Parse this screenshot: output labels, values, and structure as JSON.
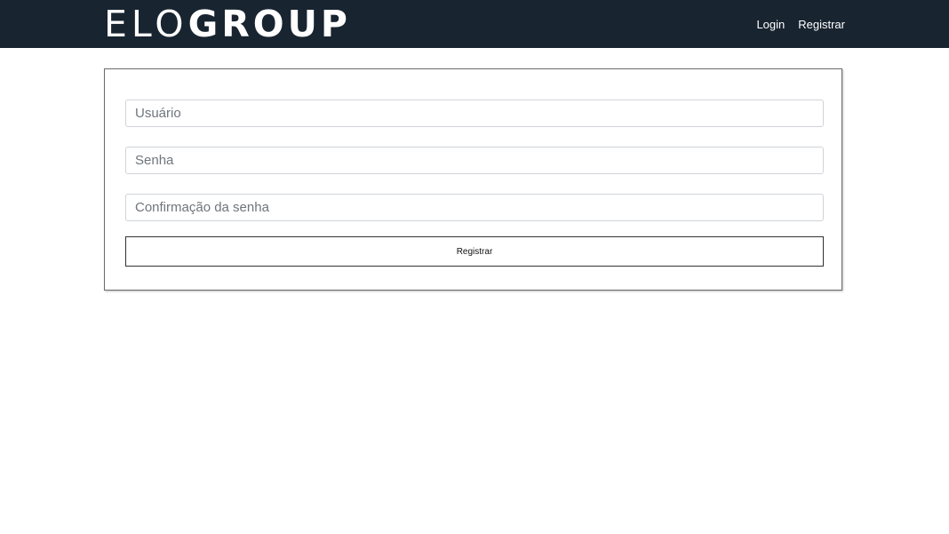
{
  "header": {
    "logo_light": "ELO",
    "logo_bold": "GROUP",
    "nav": {
      "login_label": "Login",
      "register_label": "Registrar"
    }
  },
  "form": {
    "username": {
      "placeholder": "Usuário",
      "value": ""
    },
    "password": {
      "placeholder": "Senha",
      "value": ""
    },
    "password_confirm": {
      "placeholder": "Confirmação da senha",
      "value": ""
    },
    "submit_label": "Registrar"
  },
  "colors": {
    "header_bg": "#182430",
    "header_text": "#ffffff",
    "page_bg": "#ffffff"
  }
}
